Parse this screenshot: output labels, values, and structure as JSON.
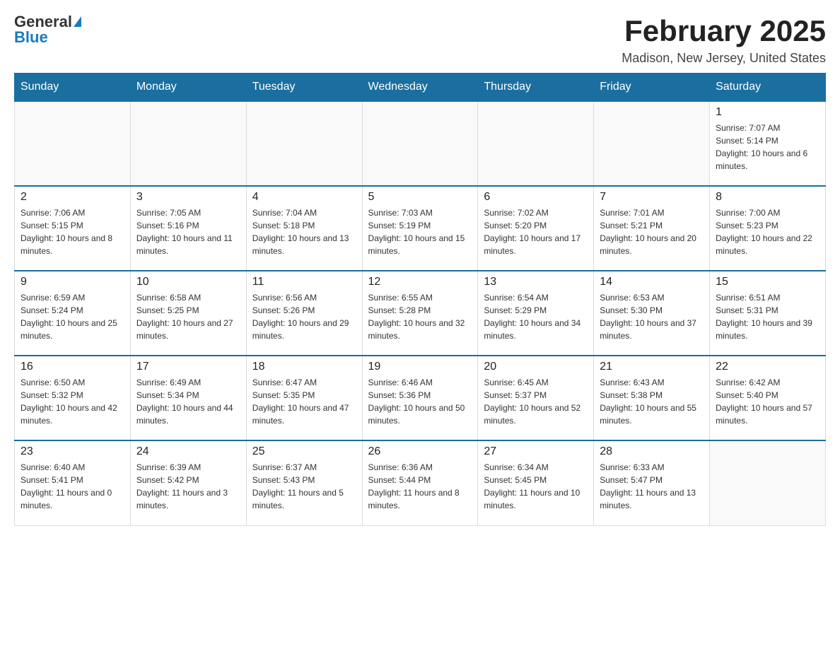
{
  "header": {
    "logo_general": "General",
    "logo_blue": "Blue",
    "main_title": "February 2025",
    "subtitle": "Madison, New Jersey, United States"
  },
  "days_of_week": [
    "Sunday",
    "Monday",
    "Tuesday",
    "Wednesday",
    "Thursday",
    "Friday",
    "Saturday"
  ],
  "weeks": [
    [
      {
        "date": "",
        "sunrise": "",
        "sunset": "",
        "daylight": ""
      },
      {
        "date": "",
        "sunrise": "",
        "sunset": "",
        "daylight": ""
      },
      {
        "date": "",
        "sunrise": "",
        "sunset": "",
        "daylight": ""
      },
      {
        "date": "",
        "sunrise": "",
        "sunset": "",
        "daylight": ""
      },
      {
        "date": "",
        "sunrise": "",
        "sunset": "",
        "daylight": ""
      },
      {
        "date": "",
        "sunrise": "",
        "sunset": "",
        "daylight": ""
      },
      {
        "date": "1",
        "sunrise": "Sunrise: 7:07 AM",
        "sunset": "Sunset: 5:14 PM",
        "daylight": "Daylight: 10 hours and 6 minutes."
      }
    ],
    [
      {
        "date": "2",
        "sunrise": "Sunrise: 7:06 AM",
        "sunset": "Sunset: 5:15 PM",
        "daylight": "Daylight: 10 hours and 8 minutes."
      },
      {
        "date": "3",
        "sunrise": "Sunrise: 7:05 AM",
        "sunset": "Sunset: 5:16 PM",
        "daylight": "Daylight: 10 hours and 11 minutes."
      },
      {
        "date": "4",
        "sunrise": "Sunrise: 7:04 AM",
        "sunset": "Sunset: 5:18 PM",
        "daylight": "Daylight: 10 hours and 13 minutes."
      },
      {
        "date": "5",
        "sunrise": "Sunrise: 7:03 AM",
        "sunset": "Sunset: 5:19 PM",
        "daylight": "Daylight: 10 hours and 15 minutes."
      },
      {
        "date": "6",
        "sunrise": "Sunrise: 7:02 AM",
        "sunset": "Sunset: 5:20 PM",
        "daylight": "Daylight: 10 hours and 17 minutes."
      },
      {
        "date": "7",
        "sunrise": "Sunrise: 7:01 AM",
        "sunset": "Sunset: 5:21 PM",
        "daylight": "Daylight: 10 hours and 20 minutes."
      },
      {
        "date": "8",
        "sunrise": "Sunrise: 7:00 AM",
        "sunset": "Sunset: 5:23 PM",
        "daylight": "Daylight: 10 hours and 22 minutes."
      }
    ],
    [
      {
        "date": "9",
        "sunrise": "Sunrise: 6:59 AM",
        "sunset": "Sunset: 5:24 PM",
        "daylight": "Daylight: 10 hours and 25 minutes."
      },
      {
        "date": "10",
        "sunrise": "Sunrise: 6:58 AM",
        "sunset": "Sunset: 5:25 PM",
        "daylight": "Daylight: 10 hours and 27 minutes."
      },
      {
        "date": "11",
        "sunrise": "Sunrise: 6:56 AM",
        "sunset": "Sunset: 5:26 PM",
        "daylight": "Daylight: 10 hours and 29 minutes."
      },
      {
        "date": "12",
        "sunrise": "Sunrise: 6:55 AM",
        "sunset": "Sunset: 5:28 PM",
        "daylight": "Daylight: 10 hours and 32 minutes."
      },
      {
        "date": "13",
        "sunrise": "Sunrise: 6:54 AM",
        "sunset": "Sunset: 5:29 PM",
        "daylight": "Daylight: 10 hours and 34 minutes."
      },
      {
        "date": "14",
        "sunrise": "Sunrise: 6:53 AM",
        "sunset": "Sunset: 5:30 PM",
        "daylight": "Daylight: 10 hours and 37 minutes."
      },
      {
        "date": "15",
        "sunrise": "Sunrise: 6:51 AM",
        "sunset": "Sunset: 5:31 PM",
        "daylight": "Daylight: 10 hours and 39 minutes."
      }
    ],
    [
      {
        "date": "16",
        "sunrise": "Sunrise: 6:50 AM",
        "sunset": "Sunset: 5:32 PM",
        "daylight": "Daylight: 10 hours and 42 minutes."
      },
      {
        "date": "17",
        "sunrise": "Sunrise: 6:49 AM",
        "sunset": "Sunset: 5:34 PM",
        "daylight": "Daylight: 10 hours and 44 minutes."
      },
      {
        "date": "18",
        "sunrise": "Sunrise: 6:47 AM",
        "sunset": "Sunset: 5:35 PM",
        "daylight": "Daylight: 10 hours and 47 minutes."
      },
      {
        "date": "19",
        "sunrise": "Sunrise: 6:46 AM",
        "sunset": "Sunset: 5:36 PM",
        "daylight": "Daylight: 10 hours and 50 minutes."
      },
      {
        "date": "20",
        "sunrise": "Sunrise: 6:45 AM",
        "sunset": "Sunset: 5:37 PM",
        "daylight": "Daylight: 10 hours and 52 minutes."
      },
      {
        "date": "21",
        "sunrise": "Sunrise: 6:43 AM",
        "sunset": "Sunset: 5:38 PM",
        "daylight": "Daylight: 10 hours and 55 minutes."
      },
      {
        "date": "22",
        "sunrise": "Sunrise: 6:42 AM",
        "sunset": "Sunset: 5:40 PM",
        "daylight": "Daylight: 10 hours and 57 minutes."
      }
    ],
    [
      {
        "date": "23",
        "sunrise": "Sunrise: 6:40 AM",
        "sunset": "Sunset: 5:41 PM",
        "daylight": "Daylight: 11 hours and 0 minutes."
      },
      {
        "date": "24",
        "sunrise": "Sunrise: 6:39 AM",
        "sunset": "Sunset: 5:42 PM",
        "daylight": "Daylight: 11 hours and 3 minutes."
      },
      {
        "date": "25",
        "sunrise": "Sunrise: 6:37 AM",
        "sunset": "Sunset: 5:43 PM",
        "daylight": "Daylight: 11 hours and 5 minutes."
      },
      {
        "date": "26",
        "sunrise": "Sunrise: 6:36 AM",
        "sunset": "Sunset: 5:44 PM",
        "daylight": "Daylight: 11 hours and 8 minutes."
      },
      {
        "date": "27",
        "sunrise": "Sunrise: 6:34 AM",
        "sunset": "Sunset: 5:45 PM",
        "daylight": "Daylight: 11 hours and 10 minutes."
      },
      {
        "date": "28",
        "sunrise": "Sunrise: 6:33 AM",
        "sunset": "Sunset: 5:47 PM",
        "daylight": "Daylight: 11 hours and 13 minutes."
      },
      {
        "date": "",
        "sunrise": "",
        "sunset": "",
        "daylight": ""
      }
    ]
  ]
}
